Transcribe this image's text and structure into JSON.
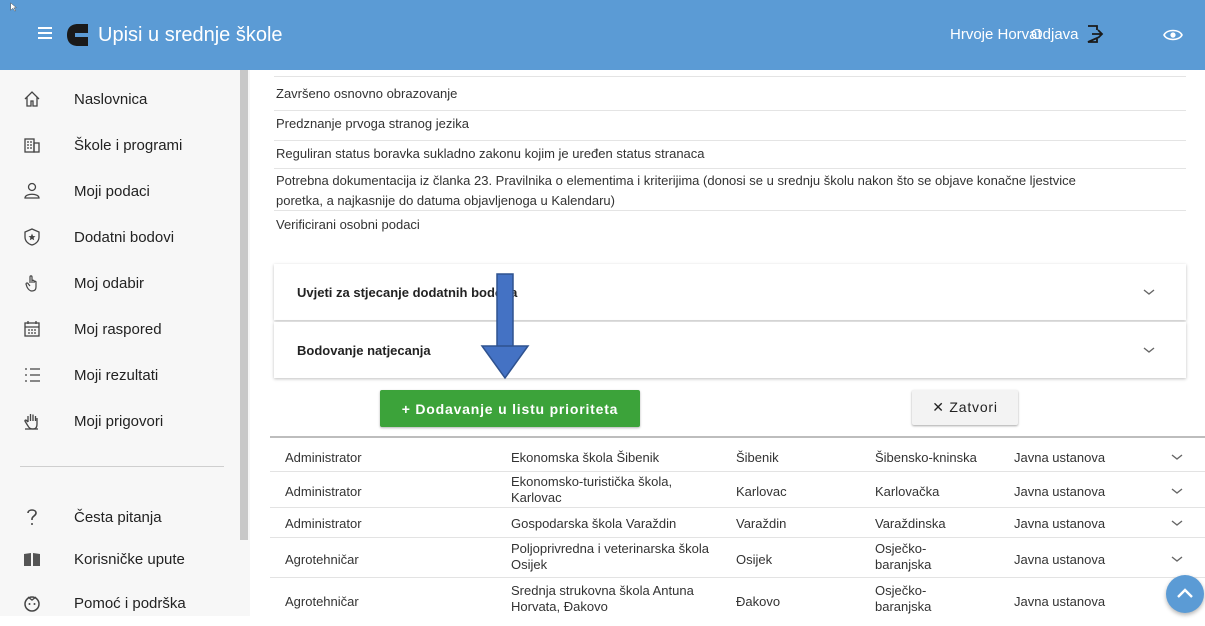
{
  "header": {
    "app_title": "Upisi u srednje škole",
    "user_name": "Hrvoje Horvat",
    "logout_label": "Odjava"
  },
  "sidebar": {
    "items": [
      {
        "label": "Naslovnica",
        "icon": "home-icon"
      },
      {
        "label": "Škole i programi",
        "icon": "building-icon"
      },
      {
        "label": "Moji podaci",
        "icon": "user-icon"
      },
      {
        "label": "Dodatni bodovi",
        "icon": "badge-star-icon"
      },
      {
        "label": "Moj odabir",
        "icon": "touch-icon"
      },
      {
        "label": "Moj raspored",
        "icon": "calendar-icon"
      },
      {
        "label": "Moji rezultati",
        "icon": "list-icon"
      },
      {
        "label": "Moji prigovori",
        "icon": "hand-icon"
      },
      {
        "label": "Česta pitanja",
        "icon": "question-icon"
      },
      {
        "label": "Korisničke upute",
        "icon": "book-icon"
      },
      {
        "label": "Pomoć i podrška",
        "icon": "support-icon"
      }
    ]
  },
  "requirements": [
    "Završeno osnovno obrazovanje",
    "Predznanje prvoga stranog jezika",
    "Reguliran status boravka sukladno zakonu kojim je uređen status stranaca",
    "Potrebna dokumentacija iz članka 23. Pravilnika o elementima i kriterijima (donosi se u srednju školu nakon što se objave konačne ljestvice",
    "poretka, a najkasnije do datuma objavljenoga u Kalendaru)",
    "Verificirani osobni podaci"
  ],
  "accordions": [
    {
      "title": "Uvjeti za stjecanje dodatnih bodova"
    },
    {
      "title": "Bodovanje natjecanja"
    }
  ],
  "actions": {
    "add_label": "+  Dodavanje u listu prioriteta",
    "close_label": "✕  Zatvori"
  },
  "table": {
    "rows": [
      {
        "program": "Administrator",
        "school": "Ekonomska škola Šibenik",
        "city": "Šibenik",
        "county": "Šibensko-kninska",
        "type": "Javna ustanova"
      },
      {
        "program": "Administrator",
        "school": "Ekonomsko-turistička škola, Karlovac",
        "city": "Karlovac",
        "county": "Karlovačka",
        "type": "Javna ustanova"
      },
      {
        "program": "Administrator",
        "school": "Gospodarska škola Varaždin",
        "city": "Varaždin",
        "county": "Varaždinska",
        "type": "Javna ustanova"
      },
      {
        "program": "Agrotehničar",
        "school": "Poljoprivredna i veterinarska škola Osijek",
        "city": "Osijek",
        "county": "Osječko-baranjska",
        "type": "Javna ustanova"
      },
      {
        "program": "Agrotehničar",
        "school": "Srednja strukovna škola Antuna Horvata, Đakovo",
        "city": "Đakovo",
        "county": "Osječko-baranjska",
        "type": "Javna ustanova"
      }
    ]
  },
  "colors": {
    "header_bg": "#5b9bd5",
    "add_button": "#3ca33a",
    "arrow": "#4472c4"
  }
}
